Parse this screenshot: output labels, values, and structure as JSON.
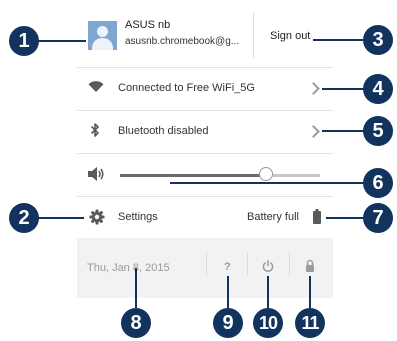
{
  "account": {
    "name": "ASUS nb",
    "email": "asusnb.chromebook@g...",
    "sign_out_label": "Sign out"
  },
  "network": {
    "label": "Connected to Free WiFi_5G"
  },
  "bluetooth": {
    "label": "Bluetooth disabled"
  },
  "volume": {
    "level": 0.73
  },
  "settings": {
    "label": "Settings"
  },
  "battery": {
    "label": "Battery full"
  },
  "footer": {
    "date": "Thu, Jan 8, 2015",
    "help_glyph": "?"
  },
  "callouts": {
    "c1": "1",
    "c2": "2",
    "c3": "3",
    "c4": "4",
    "c5": "5",
    "c6": "6",
    "c7": "7",
    "c8": "8",
    "c9": "9",
    "c10": "10",
    "c11": "11"
  },
  "colors": {
    "callout": "#13335f",
    "panel_text": "#333333",
    "icon": "#5a5a5a",
    "footer_bg": "#f2f2f2"
  },
  "icons": {
    "wifi": "wifi-icon",
    "bluetooth": "bluetooth-icon",
    "volume": "speaker-icon",
    "settings": "gear-icon",
    "battery": "battery-icon",
    "help": "help-icon",
    "power": "power-icon",
    "lock": "lock-icon",
    "chevron": "chevron-right-icon"
  }
}
